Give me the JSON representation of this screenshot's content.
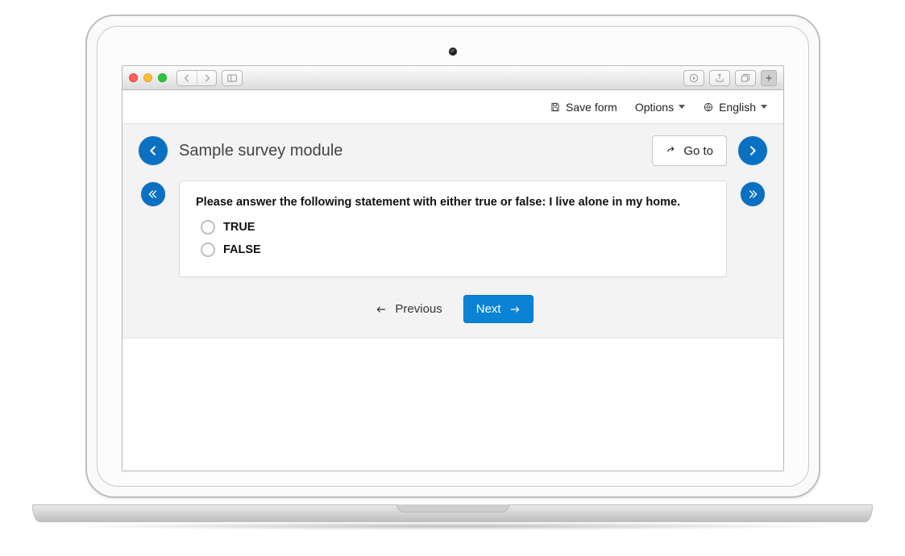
{
  "header": {
    "save_label": "Save form",
    "options_label": "Options",
    "language_label": "English"
  },
  "survey": {
    "title": "Sample survey module",
    "goto_label": "Go to",
    "question": "Please answer the following statement with either true or false: I live alone in my home.",
    "options": [
      "TRUE",
      "FALSE"
    ]
  },
  "nav": {
    "prev_label": "Previous",
    "next_label": "Next"
  }
}
